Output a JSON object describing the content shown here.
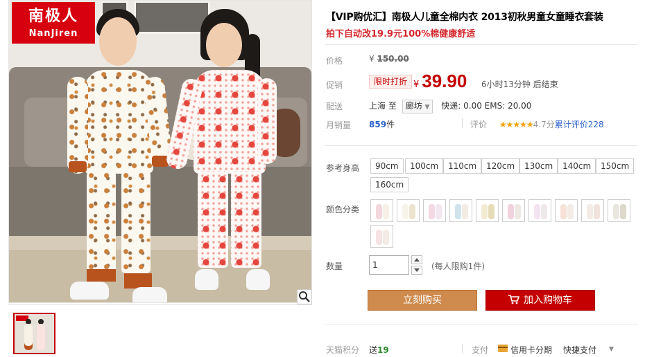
{
  "brand": {
    "name_cn": "南极人",
    "name_en": "NanJiren"
  },
  "product": {
    "title": "【VIP购优汇】南极人儿童全棉内衣 2013初秋男童女童睡衣套装",
    "subtitle": "拍下自动改19.9元100%棉健康舒适"
  },
  "price": {
    "label": "价格",
    "currency": "¥",
    "original": "150.00"
  },
  "promo": {
    "label": "促销",
    "tag": "限时打折",
    "currency": "¥",
    "price": "39.90",
    "countdown": "6小时13分钟 后结束"
  },
  "shipping": {
    "label": "配送",
    "from": "上海",
    "to_word": "至",
    "destination": "廊坊",
    "fee": "快递: 0.00 EMS: 20.00"
  },
  "sales": {
    "label": "月销量",
    "count": "859",
    "unit": "件"
  },
  "rating": {
    "label": "评价",
    "stars": "★★★★★",
    "score": "4.7分",
    "count_text": "累计评价228"
  },
  "size": {
    "label": "参考身高",
    "options": [
      "90cm",
      "100cm",
      "110cm",
      "120cm",
      "130cm",
      "140cm",
      "150cm",
      "160cm"
    ]
  },
  "color": {
    "label": "颜色分类",
    "swatches": [
      {
        "a": "#f4d7dc",
        "b": "#f7f0e6"
      },
      {
        "a": "#f6f3ea",
        "b": "#ede4d0"
      },
      {
        "a": "#f3d9e3",
        "b": "#f2e7ef"
      },
      {
        "a": "#cfe3ea",
        "b": "#f1ede4"
      },
      {
        "a": "#f2ecd2",
        "b": "#e6dcb8"
      },
      {
        "a": "#f0d2dd",
        "b": "#ede8e4"
      },
      {
        "a": "#f3e4ef",
        "b": "#efe8ea"
      },
      {
        "a": "#f6e1d8",
        "b": "#f3ece7"
      },
      {
        "a": "#f3ece6",
        "b": "#f0e3dc"
      },
      {
        "a": "#e8e6df",
        "b": "#dcd8cc"
      },
      {
        "a": "#f5e2e2",
        "b": "#f3ebe6"
      }
    ]
  },
  "quantity": {
    "label": "数量",
    "value": "1",
    "limit": "(每人限购1件)"
  },
  "actions": {
    "buy_now": "立刻购买",
    "add_to_cart": "加入购物车"
  },
  "footer": {
    "points_label": "天猫积分",
    "points_text": "送",
    "points_value": "19",
    "pay_label": "支付",
    "card_text": "信用卡分期",
    "quick_pay": "快捷支付"
  },
  "colors": {
    "accent_red": "#c40000",
    "buy_orange": "#cf8b4e",
    "link_blue": "#2b62c8",
    "star_gold": "#f3a000"
  }
}
